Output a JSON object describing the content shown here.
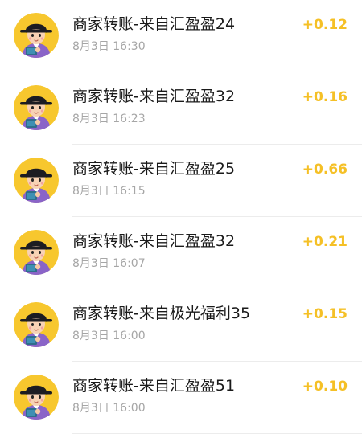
{
  "colors": {
    "amount": "#f5c026",
    "title": "#1a1a1a",
    "time": "#a6a6a6",
    "avatar_bg": "#f7c72e",
    "avatar_robe": "#8a64c8"
  },
  "avatar_icon": "cartoon-scholar-avatar-icon",
  "transactions": [
    {
      "title": "商家转账-来自汇盈盈24",
      "time": "8月3日 16:30",
      "amount": "+0.12"
    },
    {
      "title": "商家转账-来自汇盈盈32",
      "time": "8月3日 16:23",
      "amount": "+0.16"
    },
    {
      "title": "商家转账-来自汇盈盈25",
      "time": "8月3日 16:15",
      "amount": "+0.66"
    },
    {
      "title": "商家转账-来自汇盈盈32",
      "time": "8月3日 16:07",
      "amount": "+0.21"
    },
    {
      "title": "商家转账-来自极光福利35",
      "time": "8月3日 16:00",
      "amount": "+0.15"
    },
    {
      "title": "商家转账-来自汇盈盈51",
      "time": "8月3日 16:00",
      "amount": "+0.10"
    }
  ]
}
